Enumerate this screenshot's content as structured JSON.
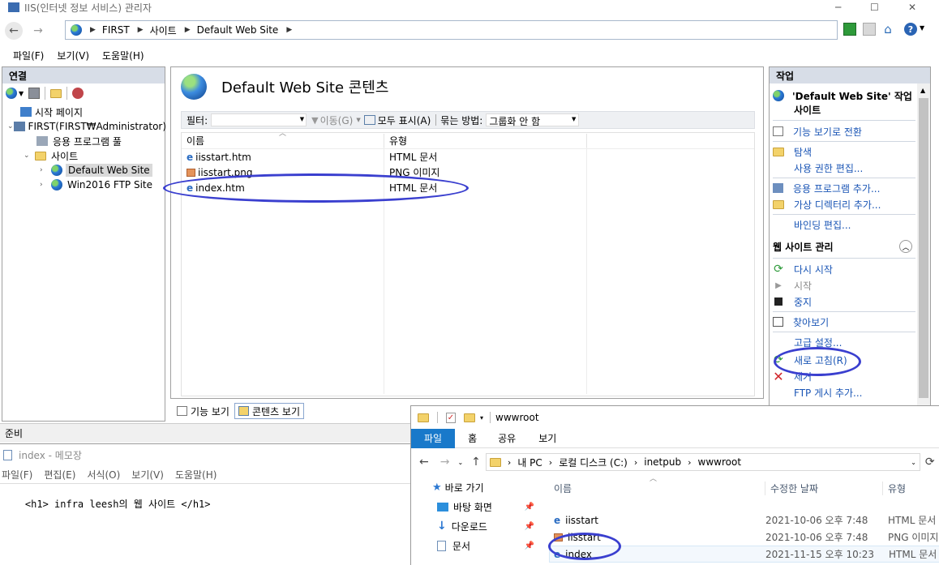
{
  "iis": {
    "window_title": "IIS(인터넷 정보 서비스) 관리자",
    "window_controls": [
      "─",
      "☐",
      "✕"
    ],
    "address": [
      "FIRST",
      "사이트",
      "Default Web Site"
    ],
    "menu": [
      "파일(F)",
      "보기(V)",
      "도움말(H)"
    ],
    "connections": {
      "header": "연결",
      "tree": [
        {
          "label": "시작 페이지",
          "indent": 0
        },
        {
          "label": "FIRST(FIRST₩Administrator)",
          "indent": 0
        },
        {
          "label": "응용 프로그램 풀",
          "indent": 1
        },
        {
          "label": "사이트",
          "indent": 1
        },
        {
          "label": "Default Web Site",
          "indent": 2
        },
        {
          "label": "Win2016 FTP Site",
          "indent": 2
        }
      ]
    },
    "content": {
      "title": "Default Web Site 콘텐츠",
      "filter_label": "필터:",
      "go_label": "이동(G)",
      "show_all_label": "모두 표시(A)",
      "group_label": "묶는 방법:",
      "group_value": "그룹화 안 함",
      "columns": [
        "이름",
        "유형"
      ],
      "files": [
        {
          "name": "iisstart.htm",
          "type": "HTML 문서"
        },
        {
          "name": "iisstart.png",
          "type": "PNG 이미지"
        },
        {
          "name": "index.htm",
          "type": "HTML 문서"
        }
      ],
      "tab_features": "기능 보기",
      "tab_content": "콘텐츠 보기"
    },
    "actions": {
      "header": "작업",
      "site_title": "'Default Web Site' 작업",
      "site_sub": "사이트",
      "items1": [
        "기능 보기로 전환"
      ],
      "explore": "탐색",
      "edit_perm": "사용 권한 편집...",
      "add_app": "응용 프로그램 추가...",
      "add_vdir": "가상 디렉터리 추가...",
      "bindings": "바인딩 편집...",
      "manage_header": "웹 사이트 관리",
      "restart": "다시 시작",
      "start": "시작",
      "stop": "중지",
      "browse": "찾아보기",
      "advanced": "고급 설정...",
      "refresh": "새로 고침(R)",
      "remove": "제거",
      "ftp": "FTP 게시 추가..."
    },
    "status": "준비"
  },
  "notepad": {
    "title": "index - 메모장",
    "menu": [
      "파일(F)",
      "편집(E)",
      "서식(O)",
      "보기(V)",
      "도움말(H)"
    ],
    "content": "<h1> infra leesh의 웹 사이트 </h1>"
  },
  "explorer": {
    "title": "wwwroot",
    "ribbon_tabs": [
      "파일",
      "홈",
      "공유",
      "보기"
    ],
    "path": [
      "내 PC",
      "로컬 디스크 (C:)",
      "inetpub",
      "wwwroot"
    ],
    "nav": [
      {
        "label": "바로 가기",
        "icon": "star-icon"
      },
      {
        "label": "바탕 화면",
        "icon": "desktop-icon"
      },
      {
        "label": "다운로드",
        "icon": "download-icon"
      },
      {
        "label": "문서",
        "icon": "document-icon"
      }
    ],
    "columns": [
      "이름",
      "수정한 날짜",
      "유형"
    ],
    "files": [
      {
        "name": "iisstart",
        "date": "2021-10-06 오후 7:48",
        "type": "HTML 문서"
      },
      {
        "name": "iisstart",
        "date": "2021-10-06 오후 7:48",
        "type": "PNG 이미지"
      },
      {
        "name": "index",
        "date": "2021-11-15 오후 10:23",
        "type": "HTML 문서"
      }
    ]
  },
  "colors": {
    "accent": "#1a55b5",
    "annotation": "#3a3fcf",
    "ribbon": "#1979ca"
  }
}
